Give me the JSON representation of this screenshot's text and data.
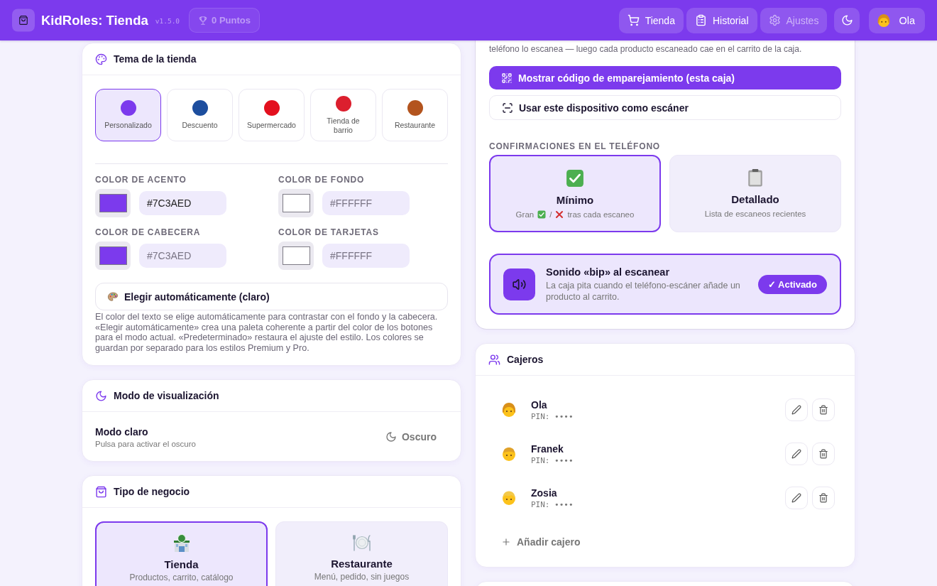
{
  "header": {
    "app_title": "KidRoles: Tienda",
    "version": "v1.5.0",
    "points": "0 Puntos",
    "nav": [
      {
        "kind": "cart",
        "label": "Tienda",
        "selected": false
      },
      {
        "kind": "clipboard",
        "label": "Historial",
        "selected": false
      },
      {
        "kind": "gear",
        "label": "Ajustes",
        "selected": true
      }
    ],
    "user": {
      "name": "Ola",
      "kind": "girl"
    }
  },
  "theme_card": {
    "title": "Tema de la tienda",
    "themes": [
      {
        "label": "Personalizado",
        "color": "#7c3aed",
        "selected": true
      },
      {
        "label": "Descuento",
        "color": "#1d4e9e",
        "selected": false
      },
      {
        "label": "Supermercado",
        "color": "#e3101e",
        "selected": false
      },
      {
        "label": "Tienda de barrio",
        "color": "#dc1f2e",
        "selected": false
      },
      {
        "label": "Restaurante",
        "color": "#b3541e",
        "selected": false
      }
    ],
    "color_fields": [
      {
        "label": "COLOR DE ACENTO",
        "value": "#7C3AED",
        "color": "#7c3aed"
      },
      {
        "label": "COLOR DE FONDO",
        "placeholder": "#FFFFFF",
        "color": "#ffffff"
      },
      {
        "label": "COLOR DE CABECERA",
        "placeholder": "#7C3AED",
        "color": "#7c3aed"
      },
      {
        "label": "COLOR DE TARJETAS",
        "placeholder": "#FFFFFF",
        "color": "#ffffff"
      }
    ],
    "auto_button": "Elegir automáticamente (claro)",
    "note": "El color del texto se elige automáticamente para contrastar con el fondo y la cabecera. «Elegir automáticamente» crea una paleta coherente a partir del color de los botones para el modo actual. «Predeterminado» restaura el ajuste del estilo. Los colores se guardan por separado para los estilos Premium y Pro."
  },
  "display_card": {
    "title": "Modo de visualización",
    "mode": "Modo claro",
    "hint": "Pulsa para activar el oscuro",
    "toggle": "Oscuro"
  },
  "business_card": {
    "title": "Tipo de negocio",
    "options": [
      {
        "kind": "store",
        "title": "Tienda",
        "subtitle": "Productos, carrito, catálogo",
        "selected": true
      },
      {
        "kind": "restaurant",
        "title": "Restaurante",
        "subtitle": "Menú, pedido, sin juegos",
        "selected": false
      }
    ]
  },
  "scanner_card": {
    "intro": "teléfono lo escanea — luego cada producto escaneado cae en el carrito de la caja.",
    "pair_button": "Mostrar código de emparejamiento (esta caja)",
    "scanner_button": "Usar este dispositivo como escáner",
    "confirm_label": "CONFIRMACIONES EN EL TELÉFONO",
    "confirm_options": [
      {
        "kind": "check",
        "title": "Mínimo",
        "caption": [
          {
            "kind": "text",
            "text": "Gran"
          },
          {
            "kind": "check"
          },
          {
            "kind": "text",
            "text": "/"
          },
          {
            "kind": "cross"
          },
          {
            "kind": "text",
            "text": "tras cada escaneo"
          }
        ],
        "selected": true
      },
      {
        "kind": "clipboard",
        "title": "Detallado",
        "caption": [
          {
            "kind": "text",
            "text": "Lista de escaneos recientes"
          }
        ],
        "selected": false
      }
    ],
    "beep": {
      "title": "Sonido «bip» al escanear",
      "description": "La caja pita cuando el teléfono-escáner añade un producto al carrito.",
      "toggle": "✓ Activado",
      "on": true
    }
  },
  "cashiers_card": {
    "title": "Cajeros",
    "cashiers": [
      {
        "kind": "girl",
        "name": "Ola",
        "pin": "PIN: ••••"
      },
      {
        "kind": "boy",
        "name": "Franek",
        "pin": "PIN: ••••"
      },
      {
        "kind": "blonde",
        "name": "Zosia",
        "pin": "PIN: ••••"
      }
    ],
    "add_button": "Añadir cajero"
  }
}
